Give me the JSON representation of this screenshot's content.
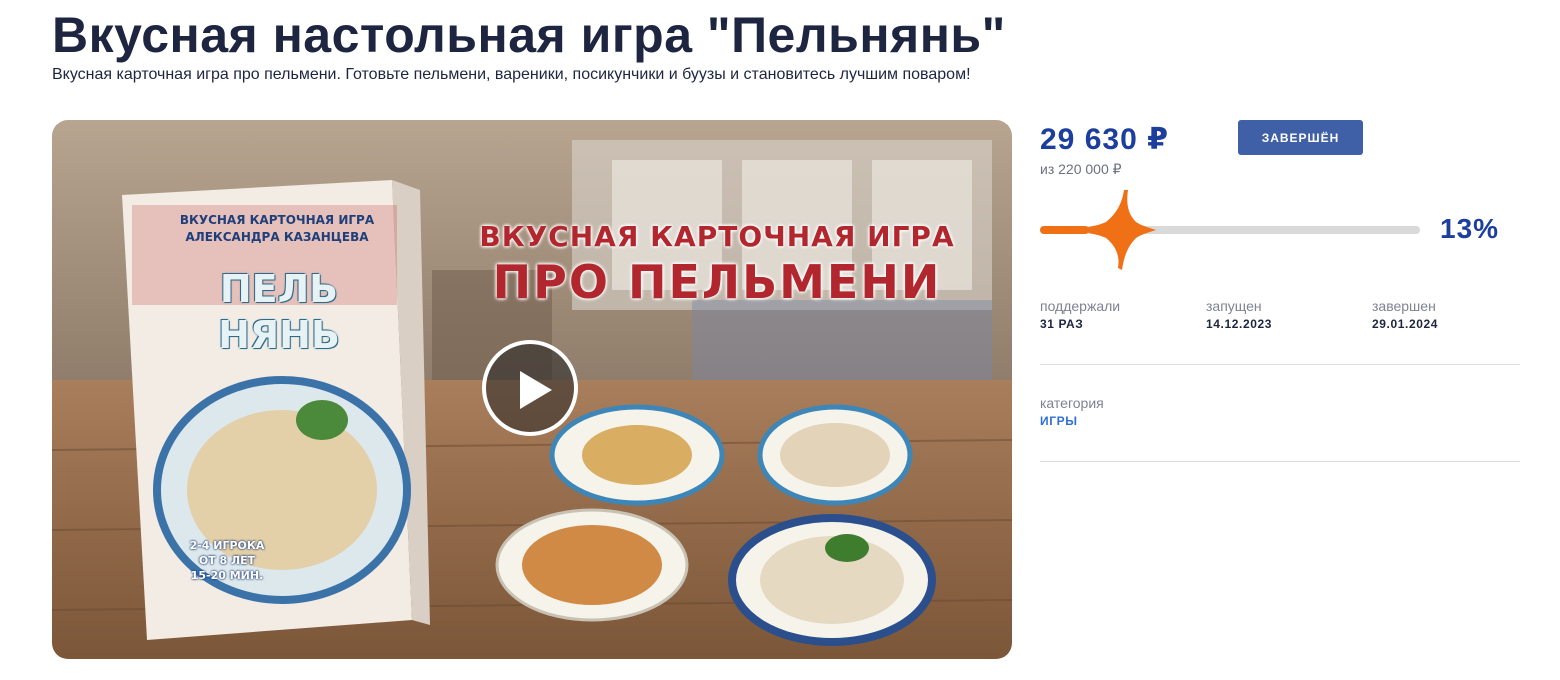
{
  "project": {
    "title": "Вкусная настольная игра \"Пельнянь\"",
    "subtitle": "Вкусная карточная игра про пельмени. Готовьте пельмени, вареники, посикунчики и буузы и становитесь лучшим поваром!"
  },
  "video": {
    "banner_line1": "ВКУСНАЯ КАРТОЧНАЯ ИГРА",
    "banner_line2": "ПРО ПЕЛЬМЕНИ",
    "box_top_line1": "ВКУСНАЯ КАРТОЧНАЯ ИГРА",
    "box_top_line2": "АЛЕКСАНДРА КАЗАНЦЕВА",
    "box_logo_line1": "ПЕЛЬ",
    "box_logo_line2": "НЯНЬ",
    "box_info_line1": "2-4 ИГРОКА",
    "box_info_line2": "ОТ 8 ЛЕТ",
    "box_info_line3": "15-20 МИН."
  },
  "funding": {
    "amount": "29 630 ₽",
    "status": "ЗАВЕРШЁН",
    "goal": "из 220 000 ₽",
    "percent_label": "13%",
    "progress_fraction": 0.13,
    "accent_color": "#f07016",
    "brand_color": "#1c3e9c"
  },
  "stats": {
    "backers_label": "поддержали",
    "backers_value": "31 РАЗ",
    "started_label": "запущен",
    "started_value": "14.12.2023",
    "finished_label": "завершен",
    "finished_value": "29.01.2024"
  },
  "category": {
    "label": "категория",
    "value": "ИГРЫ"
  }
}
